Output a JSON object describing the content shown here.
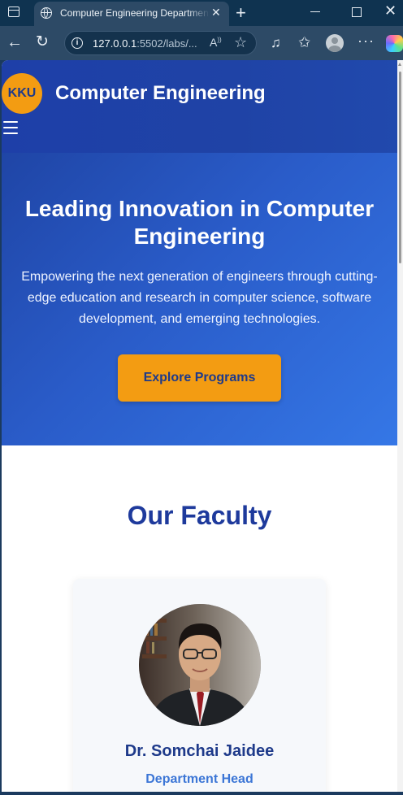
{
  "browser": {
    "tab_title": "Computer Engineering Department",
    "url_host": "127.0.0.1",
    "url_rest": ":5502/labs/...",
    "icons": [
      "tab-switcher-icon",
      "globe-icon",
      "close-icon",
      "plus-icon",
      "minimize-icon",
      "maximize-icon",
      "back-icon",
      "reload-icon",
      "info-icon",
      "read-aloud-icon",
      "star-icon",
      "extensions-icon",
      "favorites-icon",
      "profile-icon",
      "more-icon",
      "copilot-icon"
    ]
  },
  "header": {
    "logo_text": "KKU",
    "title": "Computer Engineering"
  },
  "hero": {
    "title": "Leading Innovation in Computer Engineering",
    "subtitle": "Empowering the next generation of engineers through cutting-edge education and research in computer science, software development, and emerging technologies.",
    "cta_label": "Explore Programs"
  },
  "faculty": {
    "section_title": "Our Faculty",
    "members": [
      {
        "name": "Dr. Somchai Jaidee",
        "role": "Department Head"
      }
    ]
  },
  "colors": {
    "primary": "#1e3a8a",
    "accent": "#f39c12",
    "role_text": "#3c76d6"
  }
}
